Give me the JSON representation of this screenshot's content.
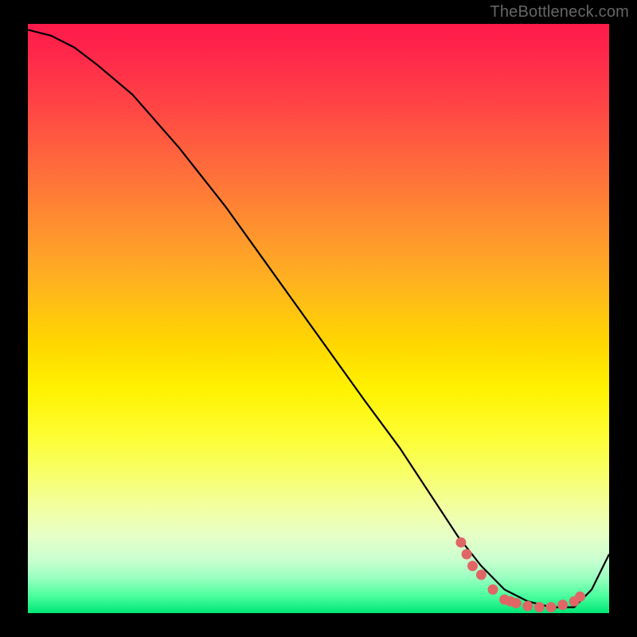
{
  "watermark": "TheBottleneck.com",
  "chart_data": {
    "type": "line",
    "title": "",
    "xlabel": "",
    "ylabel": "",
    "x_range": [
      0,
      100
    ],
    "y_range": [
      0,
      100
    ],
    "series": [
      {
        "name": "bottleneck-curve",
        "x": [
          0,
          4,
          8,
          12,
          18,
          26,
          34,
          42,
          50,
          58,
          64,
          70,
          74,
          78,
          82,
          86,
          90,
          94,
          97,
          100
        ],
        "y": [
          99,
          98,
          96,
          93,
          88,
          79,
          69,
          58,
          47,
          36,
          28,
          19,
          13,
          8,
          4,
          2,
          1,
          1,
          4,
          10
        ]
      }
    ],
    "markers": [
      {
        "x": 74.5,
        "y": 12.0
      },
      {
        "x": 75.5,
        "y": 10.0
      },
      {
        "x": 76.5,
        "y": 8.0
      },
      {
        "x": 78.0,
        "y": 6.5
      },
      {
        "x": 80.0,
        "y": 4.0
      },
      {
        "x": 82.0,
        "y": 2.3
      },
      {
        "x": 83.0,
        "y": 2.0
      },
      {
        "x": 84.0,
        "y": 1.7
      },
      {
        "x": 86.0,
        "y": 1.2
      },
      {
        "x": 88.0,
        "y": 1.0
      },
      {
        "x": 90.0,
        "y": 1.0
      },
      {
        "x": 92.0,
        "y": 1.4
      },
      {
        "x": 94.0,
        "y": 2.0
      },
      {
        "x": 95.0,
        "y": 2.8
      }
    ],
    "gradient_note": "background encodes vertical value: top=red (bad), bottom=green (good)"
  },
  "colors": {
    "curve": "#000000",
    "marker_fill": "#e06666",
    "marker_stroke": "#7a1e1e"
  }
}
